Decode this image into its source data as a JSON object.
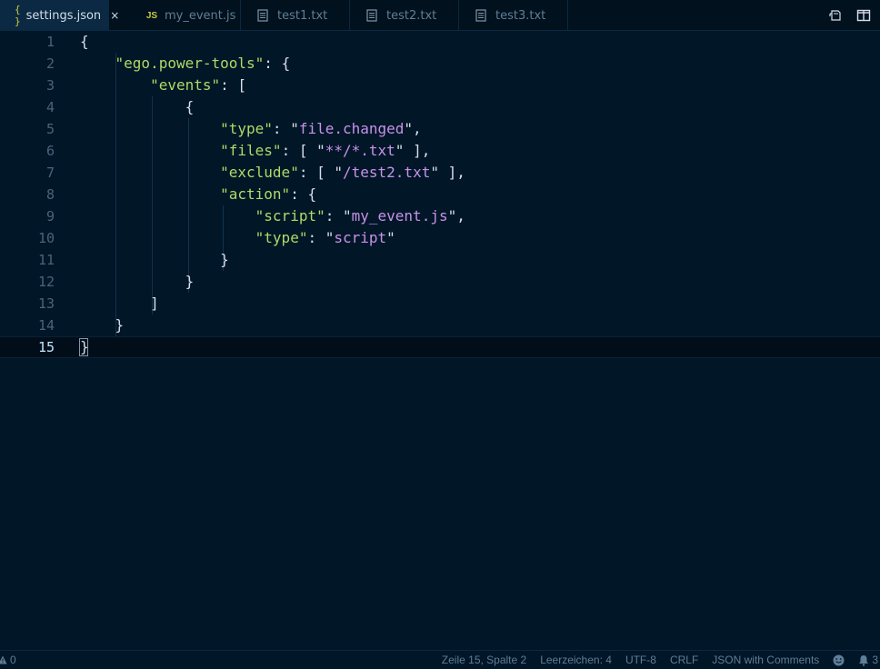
{
  "tabs": [
    {
      "label": "settings.json",
      "icon": "json-braces-icon",
      "icon_text": "{ }",
      "active": true,
      "close": "×"
    },
    {
      "label": "my_event.js",
      "icon": "javascript-file-icon",
      "icon_text": "JS",
      "active": false
    },
    {
      "label": "test1.txt",
      "icon": "text-file-icon",
      "active": false
    },
    {
      "label": "test2.txt",
      "icon": "text-file-icon",
      "active": false
    },
    {
      "label": "test3.txt",
      "icon": "text-file-icon",
      "active": false
    }
  ],
  "tab_actions": [
    "open-changes-icon",
    "split-editor-icon"
  ],
  "editor": {
    "active_line": 15,
    "lines": [
      {
        "n": "1",
        "tokens": [
          {
            "t": "p",
            "v": "{"
          }
        ]
      },
      {
        "n": "2",
        "tokens": [
          {
            "t": "p",
            "v": "    "
          },
          {
            "t": "k",
            "v": "\"ego.power-tools\""
          },
          {
            "t": "p",
            "v": ": {"
          }
        ]
      },
      {
        "n": "3",
        "tokens": [
          {
            "t": "p",
            "v": "        "
          },
          {
            "t": "k",
            "v": "\"events\""
          },
          {
            "t": "p",
            "v": ": ["
          }
        ]
      },
      {
        "n": "4",
        "tokens": [
          {
            "t": "p",
            "v": "            {"
          }
        ]
      },
      {
        "n": "5",
        "tokens": [
          {
            "t": "p",
            "v": "                "
          },
          {
            "t": "k",
            "v": "\"type\""
          },
          {
            "t": "p",
            "v": ": \""
          },
          {
            "t": "s",
            "v": "file.changed"
          },
          {
            "t": "p",
            "v": "\","
          }
        ]
      },
      {
        "n": "6",
        "tokens": [
          {
            "t": "p",
            "v": "                "
          },
          {
            "t": "k",
            "v": "\"files\""
          },
          {
            "t": "p",
            "v": ": [ \""
          },
          {
            "t": "s",
            "v": "**/*.txt"
          },
          {
            "t": "p",
            "v": "\" ],"
          }
        ]
      },
      {
        "n": "7",
        "tokens": [
          {
            "t": "p",
            "v": "                "
          },
          {
            "t": "k",
            "v": "\"exclude\""
          },
          {
            "t": "p",
            "v": ": [ \""
          },
          {
            "t": "s",
            "v": "/test2.txt"
          },
          {
            "t": "p",
            "v": "\" ],"
          }
        ]
      },
      {
        "n": "8",
        "tokens": [
          {
            "t": "p",
            "v": "                "
          },
          {
            "t": "k",
            "v": "\"action\""
          },
          {
            "t": "p",
            "v": ": {"
          }
        ]
      },
      {
        "n": "9",
        "tokens": [
          {
            "t": "p",
            "v": "                    "
          },
          {
            "t": "k",
            "v": "\"script\""
          },
          {
            "t": "p",
            "v": ": \""
          },
          {
            "t": "s",
            "v": "my_event.js"
          },
          {
            "t": "p",
            "v": "\","
          }
        ]
      },
      {
        "n": "10",
        "tokens": [
          {
            "t": "p",
            "v": "                    "
          },
          {
            "t": "k",
            "v": "\"type\""
          },
          {
            "t": "p",
            "v": ": \""
          },
          {
            "t": "s",
            "v": "script"
          },
          {
            "t": "p",
            "v": "\""
          }
        ]
      },
      {
        "n": "11",
        "tokens": [
          {
            "t": "p",
            "v": "                }"
          }
        ]
      },
      {
        "n": "12",
        "tokens": [
          {
            "t": "p",
            "v": "            }"
          }
        ]
      },
      {
        "n": "13",
        "tokens": [
          {
            "t": "p",
            "v": "        ]"
          }
        ]
      },
      {
        "n": "14",
        "tokens": [
          {
            "t": "p",
            "v": "    }"
          }
        ]
      },
      {
        "n": "15",
        "tokens": [
          {
            "t": "p",
            "v": "}"
          }
        ]
      }
    ]
  },
  "statusbar": {
    "problems_icon": "warning-triangle-icon",
    "problems_count": "0",
    "position": "Zeile 15, Spalte 2",
    "indentation": "Leerzeichen: 4",
    "encoding": "UTF-8",
    "eol": "CRLF",
    "language": "JSON with Comments",
    "feedback_icon": "smiley-icon",
    "notifications_icon": "bell-icon",
    "notifications_count": "3"
  }
}
